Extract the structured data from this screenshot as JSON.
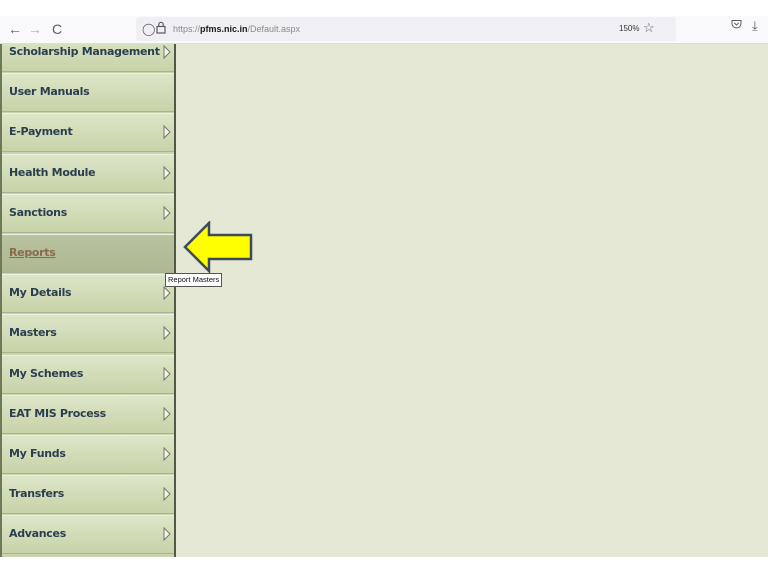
{
  "browser": {
    "back_icon": "←",
    "forward_icon": "→",
    "reload_icon": "C",
    "url_prefix": "https://",
    "url_host": "pfms.nic.in",
    "url_path": "/Default.aspx",
    "zoom_level": "150%",
    "shield_icon": "◯",
    "lock_icon": "🔒",
    "star_icon": "☆",
    "pocket_icon": "♡",
    "download_icon": "⤓"
  },
  "sidebar": {
    "items": [
      {
        "label": "Scholarship Management",
        "has_submenu": true
      },
      {
        "label": "User Manuals",
        "has_submenu": false
      },
      {
        "label": "E-Payment",
        "has_submenu": true
      },
      {
        "label": "Health Module",
        "has_submenu": true
      },
      {
        "label": "Sanctions",
        "has_submenu": true
      },
      {
        "label": "Reports",
        "has_submenu": false,
        "active": true
      },
      {
        "label": "My Details",
        "has_submenu": true
      },
      {
        "label": "Masters",
        "has_submenu": true
      },
      {
        "label": "My Schemes",
        "has_submenu": true
      },
      {
        "label": "EAT MIS Process",
        "has_submenu": true
      },
      {
        "label": "My Funds",
        "has_submenu": true
      },
      {
        "label": "Transfers",
        "has_submenu": true
      },
      {
        "label": "Advances",
        "has_submenu": true
      }
    ]
  },
  "tooltip": {
    "text": "Report Masters"
  },
  "annotation": {
    "arrow_color": "#ffff00",
    "arrow_stroke": "#3c4a5a"
  }
}
